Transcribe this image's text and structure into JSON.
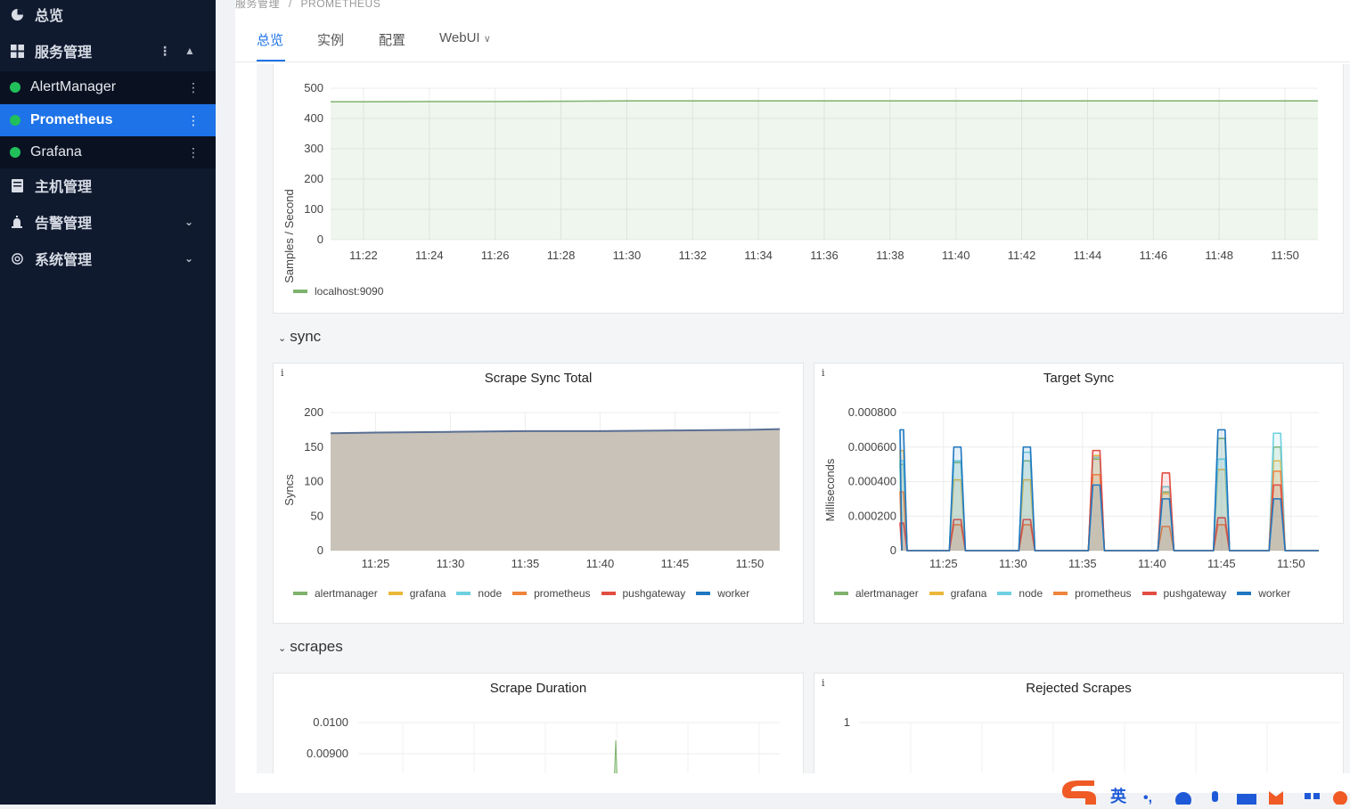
{
  "sidebar": {
    "overview": "总览",
    "service_mgmt": "服务管理",
    "services": [
      "AlertManager",
      "Prometheus",
      "Grafana"
    ],
    "host_mgmt": "主机管理",
    "alert_mgmt": "告警管理",
    "system_mgmt": "系统管理"
  },
  "breadcrumb": {
    "parent": "服务管理",
    "sep": "/",
    "current": "PROMETHEUS"
  },
  "tabs": [
    "总览",
    "实例",
    "配置",
    "WebUI"
  ],
  "panels": {
    "samples": {
      "ylabel": "Samples / Second",
      "yticks": [
        "500",
        "400",
        "300",
        "200",
        "100",
        "0"
      ],
      "xticks": [
        "11:22",
        "11:24",
        "11:26",
        "11:28",
        "11:30",
        "11:32",
        "11:34",
        "11:36",
        "11:38",
        "11:40",
        "11:42",
        "11:44",
        "11:46",
        "11:48",
        "11:50"
      ],
      "legend": [
        "localhost:9090"
      ]
    },
    "sync_section": "sync",
    "scrape_sync": {
      "info": "i",
      "title": "Scrape Sync Total",
      "ylabel": "Syncs",
      "yticks": [
        "200",
        "150",
        "100",
        "50",
        "0"
      ],
      "xticks": [
        "11:25",
        "11:30",
        "11:35",
        "11:40",
        "11:45",
        "11:50"
      ]
    },
    "target_sync": {
      "info": "i",
      "title": "Target Sync",
      "ylabel": "Milliseconds",
      "yticks": [
        "0.000800",
        "0.000600",
        "0.000400",
        "0.000200",
        "0"
      ],
      "xticks": [
        "11:25",
        "11:30",
        "11:35",
        "11:40",
        "11:45",
        "11:50"
      ]
    },
    "series_legend": [
      {
        "name": "alertmanager",
        "color": "#7eb26d"
      },
      {
        "name": "grafana",
        "color": "#eab839"
      },
      {
        "name": "node",
        "color": "#6ed0e0"
      },
      {
        "name": "prometheus",
        "color": "#ef843c"
      },
      {
        "name": "pushgateway",
        "color": "#e24d42"
      },
      {
        "name": "worker",
        "color": "#1f78c1"
      }
    ],
    "scrapes_section": "scrapes",
    "scrape_duration": {
      "title": "Scrape Duration",
      "yticks": [
        "0.0100",
        "0.00900"
      ]
    },
    "rejected_scrapes": {
      "info": "i",
      "title": "Rejected Scrapes",
      "yticks": [
        "1"
      ]
    }
  },
  "ime": {
    "lang": "英"
  },
  "colors": {
    "sidebar_bg": "#101a2f",
    "active_item": "#1e73e8",
    "status_green": "#21c05a",
    "series_green": "#7eb26d"
  },
  "chart_data": [
    {
      "type": "area",
      "ylabel": "Samples / Second",
      "ylim": [
        0,
        500
      ],
      "x": [
        "11:21",
        "11:22",
        "11:24",
        "11:26",
        "11:28",
        "11:30",
        "11:32",
        "11:34",
        "11:36",
        "11:38",
        "11:40",
        "11:42",
        "11:44",
        "11:46",
        "11:48",
        "11:50",
        "11:51"
      ],
      "series": [
        {
          "name": "localhost:9090",
          "values": [
            455,
            455,
            456,
            456,
            457,
            458,
            458,
            458,
            458,
            458,
            458,
            458,
            458,
            458,
            458,
            458,
            458
          ]
        }
      ]
    },
    {
      "type": "area",
      "title": "Scrape Sync Total",
      "ylabel": "Syncs",
      "ylim": [
        0,
        200
      ],
      "x": [
        "11:22",
        "11:25",
        "11:30",
        "11:35",
        "11:40",
        "11:45",
        "11:50",
        "11:52"
      ],
      "series": [
        {
          "values": [
            170,
            171,
            172,
            173,
            173,
            174,
            175,
            176
          ]
        }
      ]
    },
    {
      "type": "line",
      "title": "Target Sync",
      "ylabel": "Milliseconds",
      "ylim": [
        0,
        0.0008
      ],
      "x_spikes_at": [
        "11:22",
        "11:26",
        "11:31",
        "11:36",
        "11:41",
        "11:45",
        "11:49"
      ],
      "series": [
        {
          "name": "alertmanager",
          "values": [
            0.0005,
            0.00051,
            0.00052,
            0.00053,
            0.00034,
            0.00065,
            0.0006
          ]
        },
        {
          "name": "grafana",
          "values": [
            0.00058,
            0.00041,
            0.00041,
            0.00055,
            0.00033,
            0.00047,
            0.00052
          ]
        },
        {
          "name": "node",
          "values": [
            0.00052,
            0.00052,
            0.00057,
            0.00054,
            0.00037,
            0.00053,
            0.00068
          ]
        },
        {
          "name": "prometheus",
          "values": [
            0.00034,
            0.00015,
            0.00015,
            0.00044,
            0.00014,
            0.00015,
            0.00046
          ]
        },
        {
          "name": "pushgateway",
          "values": [
            0.00016,
            0.00018,
            0.00018,
            0.00058,
            0.00045,
            0.00019,
            0.00038
          ]
        },
        {
          "name": "worker",
          "values": [
            0.0007,
            0.0006,
            0.0006,
            0.00038,
            0.0003,
            0.0007,
            0.0003
          ]
        }
      ]
    }
  ]
}
